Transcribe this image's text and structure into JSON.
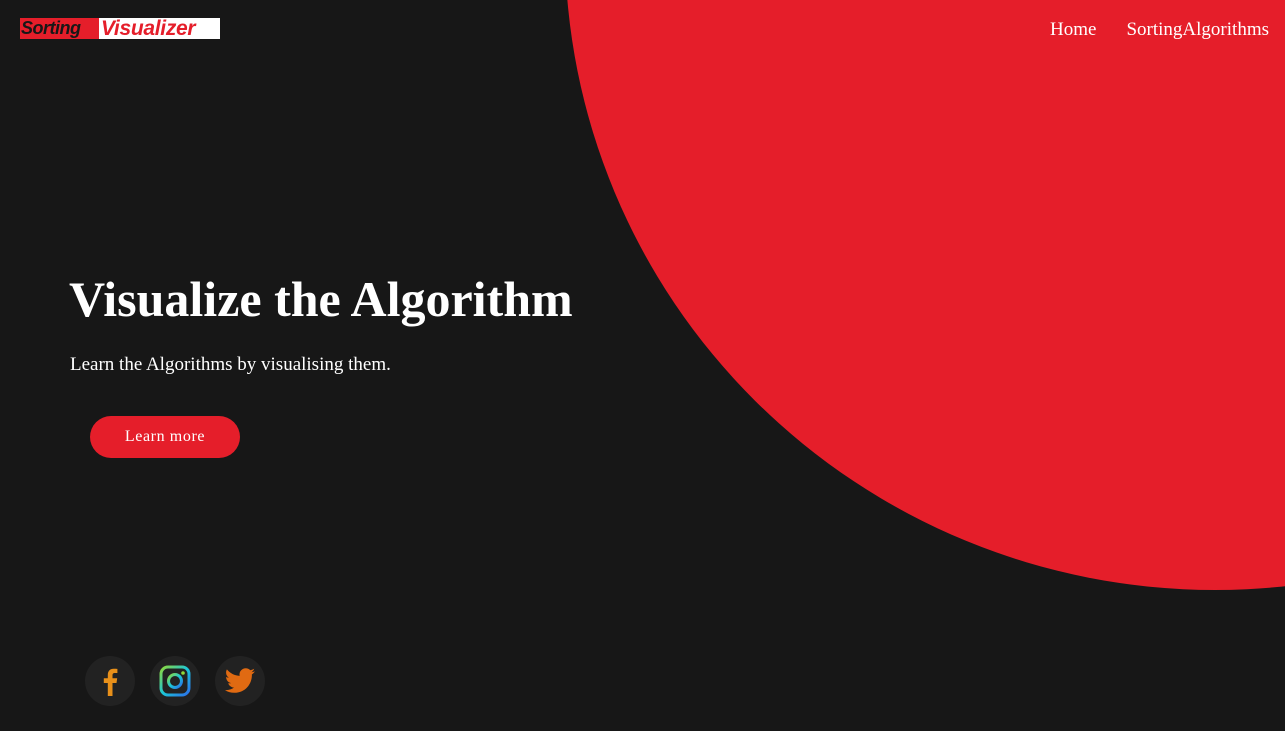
{
  "logo": {
    "part1": "Sorting",
    "part2": "Visualizer"
  },
  "nav": {
    "items": [
      "Home",
      "SortingAlgorithms"
    ]
  },
  "hero": {
    "title": "Visualize the Algorithm",
    "subtitle": "Learn the Algorithms by visualising them.",
    "button_label": "Learn more"
  },
  "socials": {
    "icons": [
      "facebook-icon",
      "instagram-icon",
      "twitter-icon"
    ]
  },
  "colors": {
    "background": "#171717",
    "accent": "#e51e2a",
    "facebook": "#e8901a",
    "twitter": "#e06a12"
  }
}
